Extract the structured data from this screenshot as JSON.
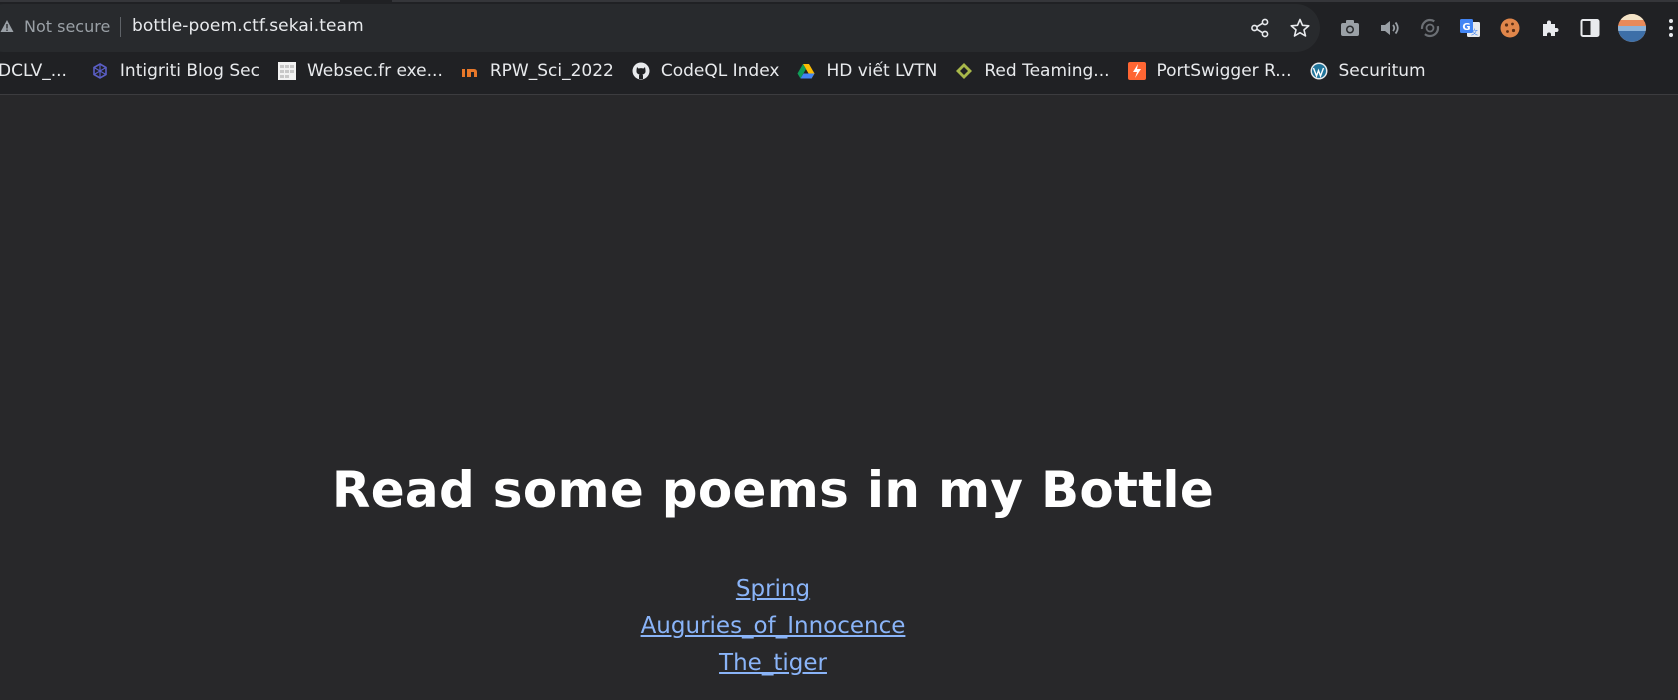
{
  "browser": {
    "security_label": "Not secure",
    "url": "bottle-poem.ctf.sekai.team",
    "toolbar_icons": [
      "share-icon",
      "star-icon",
      "camera-icon",
      "speaker-icon",
      "sync-icon",
      "translate-icon",
      "cookie-icon",
      "puzzle-icon",
      "side-panel-icon",
      "profile-avatar",
      "kebab-menu-icon"
    ]
  },
  "bookmarks": [
    {
      "label": "DCLV_...",
      "icon": "bookmark-icon"
    },
    {
      "label": "Intigriti Blog Sec",
      "icon": "intigriti-icon"
    },
    {
      "label": "Websec.fr exe...",
      "icon": "websec-icon"
    },
    {
      "label": "RPW_Sci_2022",
      "icon": "medium-icon"
    },
    {
      "label": "CodeQL Index",
      "icon": "github-icon"
    },
    {
      "label": "HD viết LVTN",
      "icon": "google-drive-icon"
    },
    {
      "label": "Red Teaming...",
      "icon": "redteam-icon"
    },
    {
      "label": "PortSwigger R...",
      "icon": "portswigger-icon"
    },
    {
      "label": "Securitum",
      "icon": "wordpress-icon"
    }
  ],
  "page": {
    "heading": "Read some poems in my Bottle",
    "poems": [
      {
        "label": "Spring"
      },
      {
        "label": "Auguries_of_Innocence"
      },
      {
        "label": "The_tiger"
      }
    ]
  },
  "colors": {
    "page_bg": "#28282a",
    "chrome_bg": "#202124",
    "link": "#8ab4f8",
    "text": "#e8eaed"
  }
}
